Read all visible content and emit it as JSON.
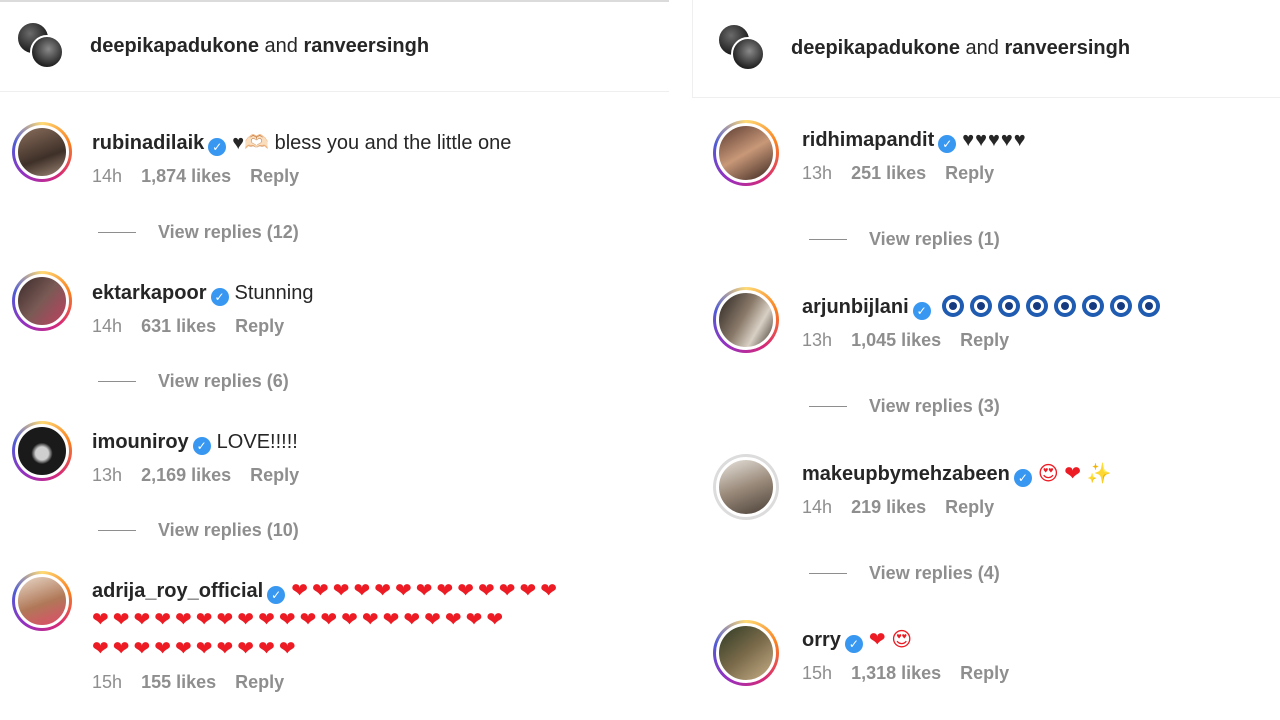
{
  "left": {
    "header": {
      "user1": "deepikapadukone",
      "and": "and",
      "user2": "ranveersingh"
    },
    "comments": [
      {
        "username": "rubinadilaik",
        "text": "♥🫶🏻 bless you and the little one",
        "time": "14h",
        "likes": "1,874 likes",
        "reply": "Reply",
        "view_replies": "View replies (12)"
      },
      {
        "username": "ektarkapoor",
        "text": "Stunning",
        "time": "14h",
        "likes": "631 likes",
        "reply": "Reply",
        "view_replies": "View replies (6)"
      },
      {
        "username": "imouniroy",
        "text": "LOVE!!!!!",
        "time": "13h",
        "likes": "2,169 likes",
        "reply": "Reply",
        "view_replies": "View replies (10)"
      },
      {
        "username": "adrija_roy_official",
        "hearts_line1": "❤❤❤❤❤❤❤❤❤❤❤❤❤",
        "hearts_line2": "❤❤❤❤❤❤❤❤❤❤❤❤❤❤❤❤❤❤❤❤",
        "hearts_line3": "❤❤❤❤❤❤❤❤❤❤",
        "time": "15h",
        "likes": "155 likes",
        "reply": "Reply"
      }
    ]
  },
  "right": {
    "header": {
      "user1": "deepikapadukone",
      "and": "and",
      "user2": "ranveersingh"
    },
    "comments": [
      {
        "username": "ridhimapandit",
        "text": "♥♥♥♥♥",
        "time": "13h",
        "likes": "251 likes",
        "reply": "Reply",
        "view_replies": "View replies (1)"
      },
      {
        "username": "arjunbijlani",
        "text": "",
        "time": "13h",
        "likes": "1,045 likes",
        "reply": "Reply",
        "view_replies": "View replies (3)"
      },
      {
        "username": "makeupbymehzabeen",
        "text": "😍 ❤ ✨",
        "time": "14h",
        "likes": "219 likes",
        "reply": "Reply",
        "view_replies": "View replies (4)"
      },
      {
        "username": "orry",
        "text": "❤ 😍",
        "time": "15h",
        "likes": "1,318 likes",
        "reply": "Reply"
      }
    ]
  },
  "icons": {
    "verified": "verified-badge-icon",
    "nazar": "evil-eye-icon"
  },
  "colors": {
    "verified": "#3897f0",
    "heart": "#ed1c24",
    "meta_gray": "#8e8e8e",
    "text": "#262626"
  }
}
